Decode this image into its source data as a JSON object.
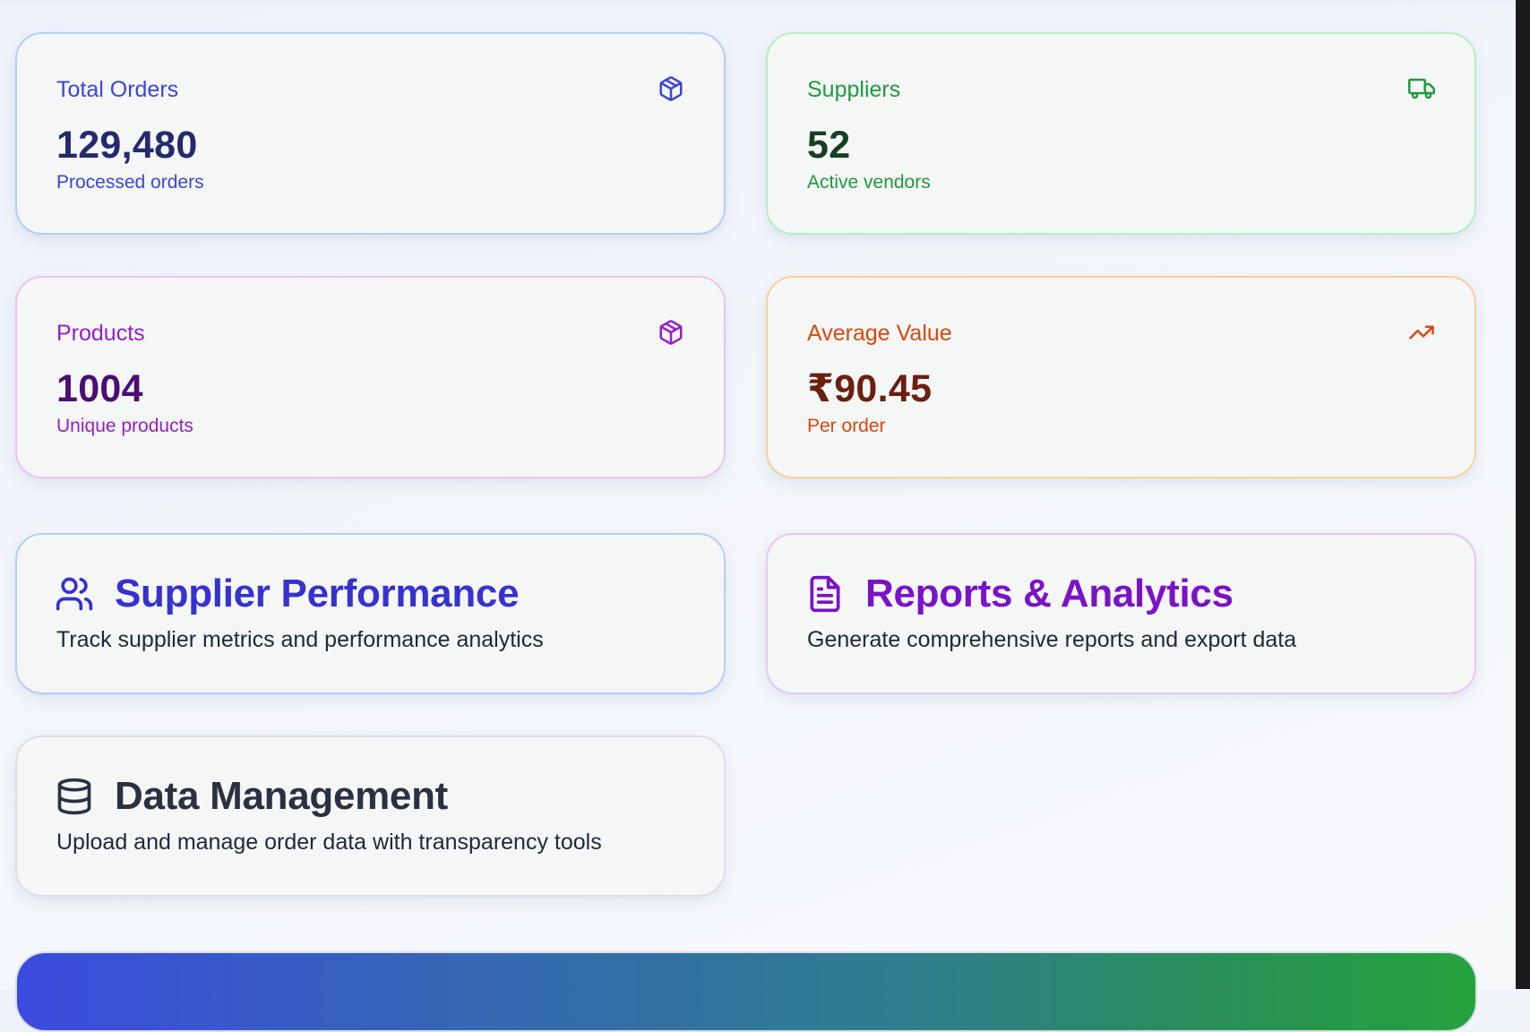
{
  "stats": [
    {
      "label": "Total Orders",
      "value": "129,480",
      "sub": "Processed orders",
      "icon": "package-icon",
      "color": "#3b46d6",
      "value_color": "#232a6e"
    },
    {
      "label": "Suppliers",
      "value": "52",
      "sub": "Active vendors",
      "icon": "truck-icon",
      "color": "#1f9a3f",
      "value_color": "#163f23"
    },
    {
      "label": "Products",
      "value": "1004",
      "sub": "Unique products",
      "icon": "package-icon",
      "color": "#9620c6",
      "value_color": "#4c0e72"
    },
    {
      "label": "Average Value",
      "value": "₹90.45",
      "sub": "Per order",
      "icon": "trending-up-icon",
      "color": "#d9480f",
      "value_color": "#6b2010"
    }
  ],
  "features": [
    {
      "title": "Supplier Performance",
      "description": "Track supplier metrics and performance analytics",
      "icon": "users-icon",
      "color": "#3532d0"
    },
    {
      "title": "Reports & Analytics",
      "description": "Generate comprehensive reports and export data",
      "icon": "file-text-icon",
      "color": "#7a12c8"
    },
    {
      "title": "Data Management",
      "description": "Upload and manage order data with transparency tools",
      "icon": "database-icon",
      "color": "#2b3142"
    }
  ]
}
